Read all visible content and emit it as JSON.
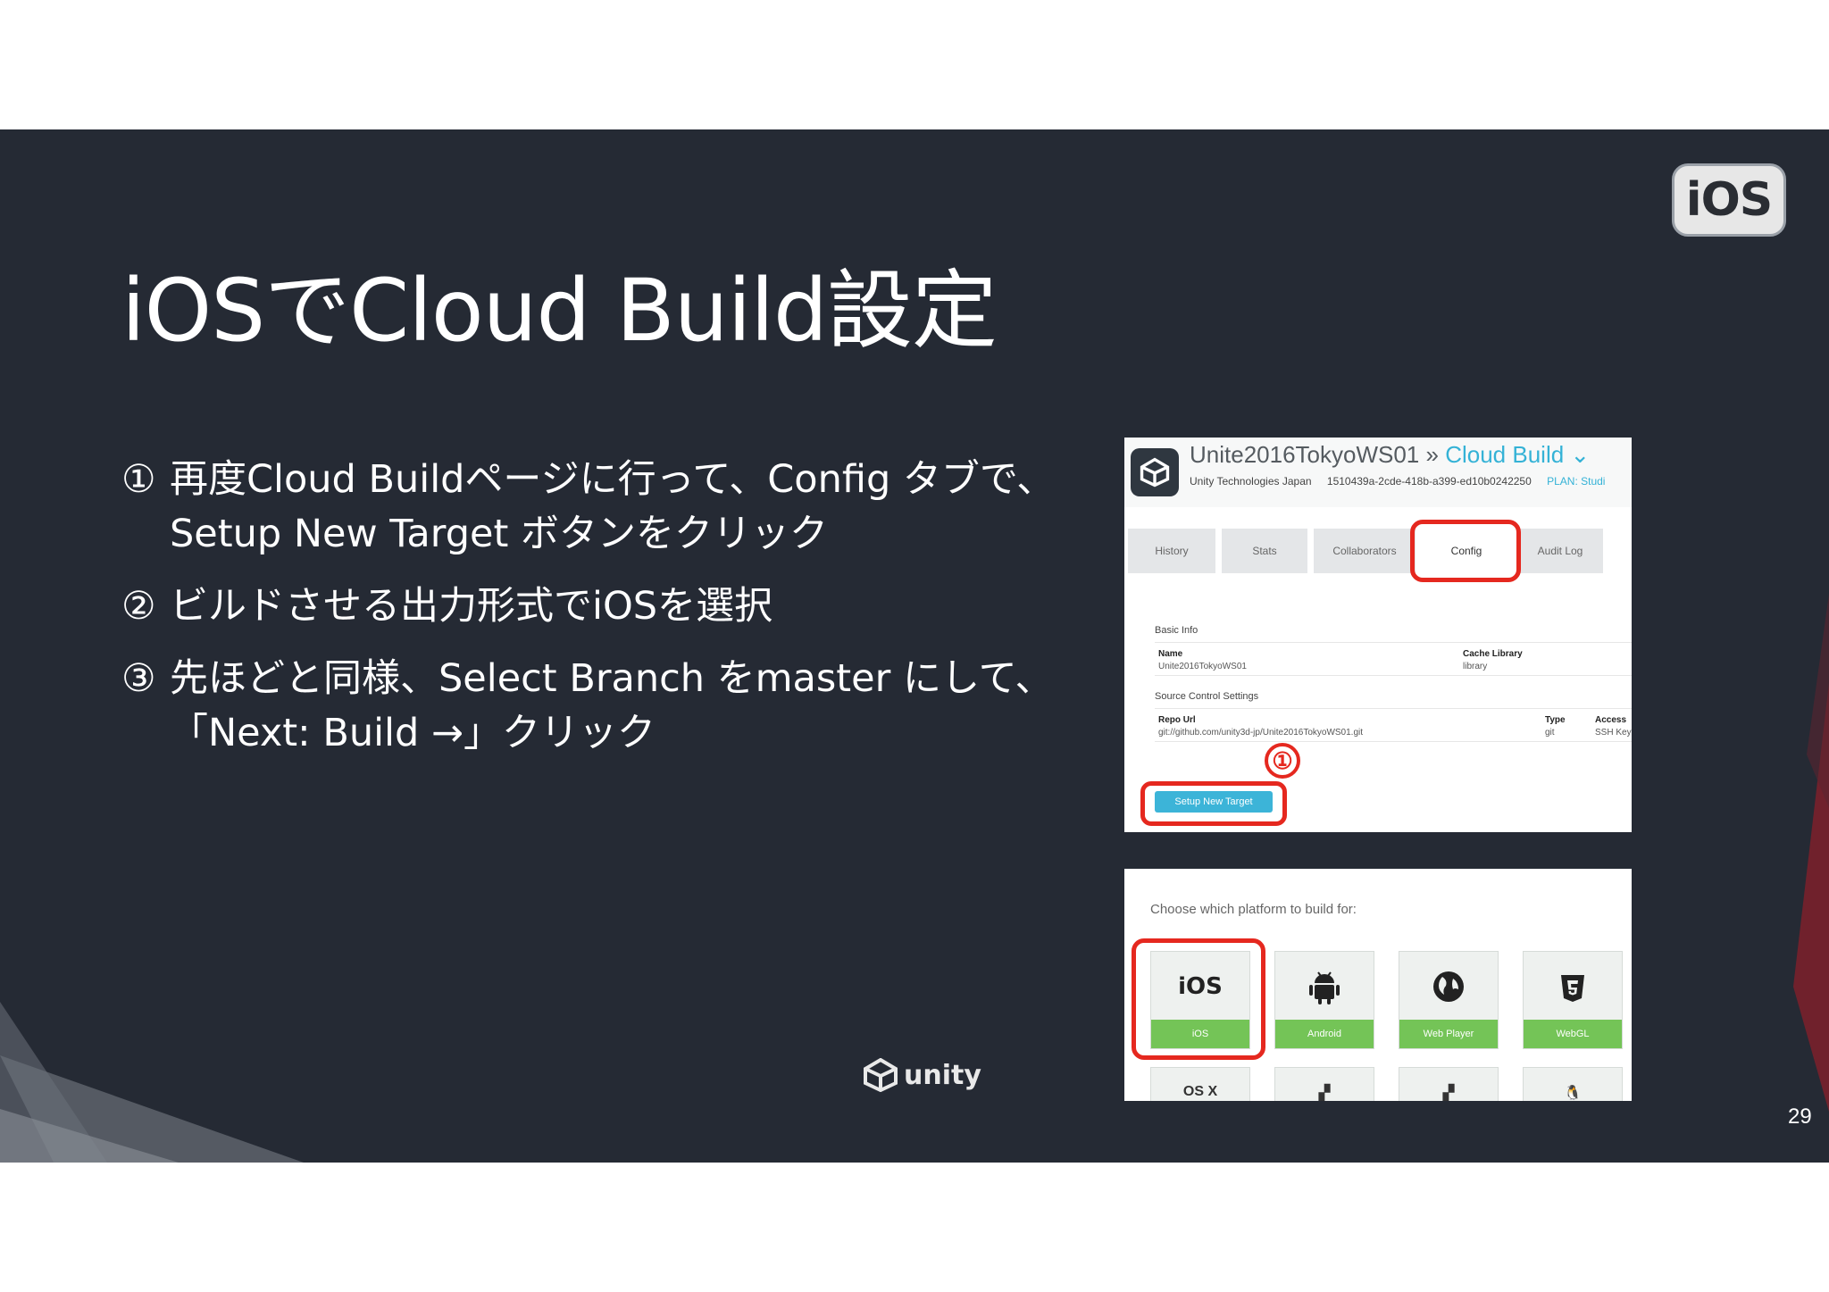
{
  "slide": {
    "title": "iOSでCloud Build設定",
    "badge": "iOS",
    "page_number": "29",
    "brand": "unity"
  },
  "bullets": [
    {
      "num": "①",
      "lines": [
        "再度Cloud Buildページに行って、Config タブで、",
        "Setup New Target ボタンをクリック"
      ]
    },
    {
      "num": "②",
      "lines": [
        "ビルドさせる出力形式でiOSを選択"
      ]
    },
    {
      "num": "③",
      "lines": [
        "先ほどと同様、Select Branch をmaster にして、",
        "「Next: Build →」クリック"
      ]
    }
  ],
  "cloud_build_config": {
    "project": "Unite2016TokyoWS01",
    "separator": "»",
    "product": "Cloud Build",
    "org": "Unity Technologies Japan",
    "project_id": "1510439a-2cde-418b-a399-ed10b0242250",
    "plan": "PLAN: Studi",
    "tabs": [
      "History",
      "Stats",
      "Collaborators",
      "Config",
      "Audit Log"
    ],
    "active_tab": "Config",
    "basic_info": "Basic Info",
    "name_label": "Name",
    "name_value": "Unite2016TokyoWS01",
    "cache_label": "Cache Library",
    "cache_value": "library",
    "source_control": "Source Control Settings",
    "repo_label": "Repo Url",
    "repo_value": "git://github.com/unity3d-jp/Unite2016TokyoWS01.git",
    "type_label": "Type",
    "type_value": "git",
    "access_label": "Access",
    "access_value": "SSH Key",
    "setup_button": "Setup New Target",
    "marker": "①"
  },
  "platform_picker": {
    "prompt": "Choose which platform to build for:",
    "platforms": [
      "iOS",
      "Android",
      "Web Player",
      "WebGL"
    ],
    "ios_glyph": "iOS",
    "second_row_first": "OS X"
  },
  "colors": {
    "slide_bg": "#252a34",
    "highlight_red": "#e5281f",
    "cloud_build_blue": "#34b2d6",
    "platform_green": "#74c457"
  }
}
